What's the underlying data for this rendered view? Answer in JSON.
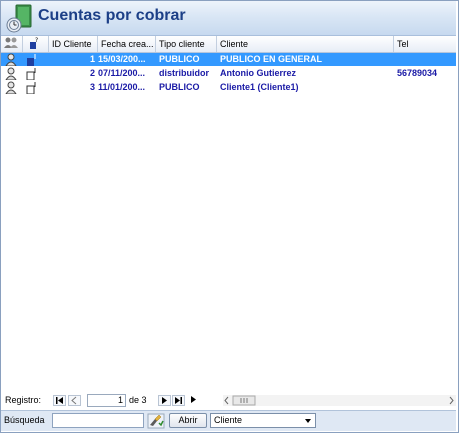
{
  "header": {
    "title": "Cuentas por cobrar"
  },
  "columns": {
    "id": "ID Cliente",
    "fecha": "Fecha crea...",
    "tipo": "Tipo cliente",
    "cliente": "Cliente",
    "tel": "Tel"
  },
  "rows": [
    {
      "id": "1",
      "fecha": "15/03/200...",
      "tipo": "PUBLICO",
      "cliente": "PUBLICO EN GENERAL",
      "tel": ""
    },
    {
      "id": "2",
      "fecha": "07/11/200...",
      "tipo": "distribuidor",
      "cliente": "Antonio Gutierrez",
      "tel": "56789034"
    },
    {
      "id": "3",
      "fecha": "11/01/200...",
      "tipo": "PUBLICO",
      "cliente": "Cliente1  (Cliente1)",
      "tel": ""
    }
  ],
  "nav": {
    "label": "Registro:",
    "current": "1",
    "of_text": "de 3"
  },
  "search": {
    "label": "Búsqueda",
    "value": "",
    "open_label": "Abrir",
    "field_selected": "Cliente"
  },
  "colors": {
    "selected_row": "#3399ff",
    "row_text": "#1a1aa6",
    "title": "#1c3f87"
  }
}
